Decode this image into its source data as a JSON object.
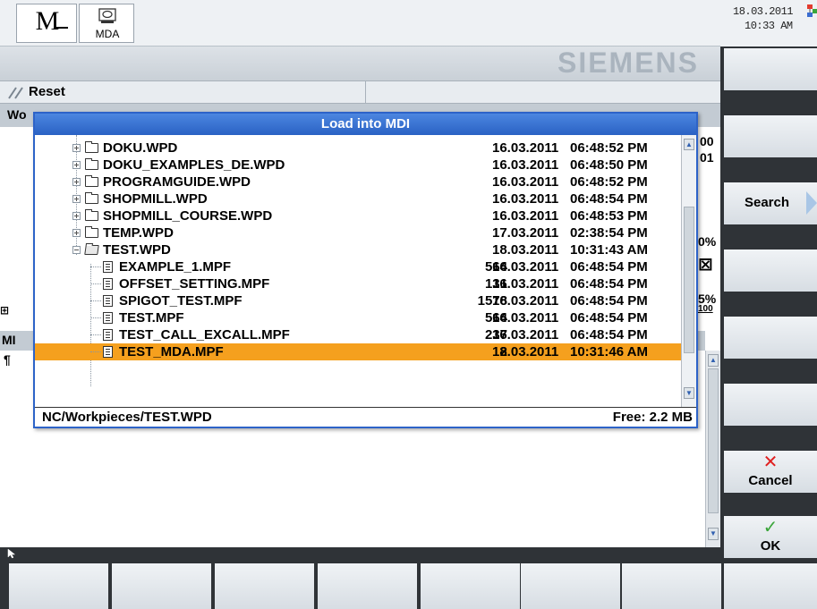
{
  "header": {
    "op_mode_letter": "M",
    "mode_label": "MDA",
    "date": "18.03.2011",
    "time": "10:33 AM"
  },
  "vendor": {
    "logo_text": "SIEMENS"
  },
  "channel_state": {
    "reset_label": "Reset"
  },
  "background": {
    "work_head": "Wo",
    "frag_00": "00",
    "frag_01": "01",
    "frag_pct1": "0%",
    "frag_pct2": "5%",
    "frag_100": "100",
    "frag_mi": "MI",
    "frag_para": "¶"
  },
  "dialog": {
    "title": "Load into MDI",
    "rows": [
      {
        "name": "DOKU.WPD",
        "size": "",
        "date": "16.03.2011",
        "time": "06:48:52 PM"
      },
      {
        "name": "DOKU_EXAMPLES_DE.WPD",
        "size": "",
        "date": "16.03.2011",
        "time": "06:48:50 PM"
      },
      {
        "name": "PROGRAMGUIDE.WPD",
        "size": "",
        "date": "16.03.2011",
        "time": "06:48:52 PM"
      },
      {
        "name": "SHOPMILL.WPD",
        "size": "",
        "date": "16.03.2011",
        "time": "06:48:54 PM"
      },
      {
        "name": "SHOPMILL_COURSE.WPD",
        "size": "",
        "date": "16.03.2011",
        "time": "06:48:53 PM"
      },
      {
        "name": "TEMP.WPD",
        "size": "",
        "date": "17.03.2011",
        "time": "02:38:54 PM"
      },
      {
        "name": "TEST.WPD",
        "size": "",
        "date": "18.03.2011",
        "time": "10:31:43 AM"
      },
      {
        "name": "EXAMPLE_1.MPF",
        "size": "564",
        "date": "16.03.2011",
        "time": "06:48:54 PM"
      },
      {
        "name": "OFFSET_SETTING.MPF",
        "size": "131",
        "date": "16.03.2011",
        "time": "06:48:54 PM"
      },
      {
        "name": "SPIGOT_TEST.MPF",
        "size": "1578",
        "date": "16.03.2011",
        "time": "06:48:54 PM"
      },
      {
        "name": "TEST.MPF",
        "size": "564",
        "date": "16.03.2011",
        "time": "06:48:54 PM"
      },
      {
        "name": "TEST_CALL_EXCALL.MPF",
        "size": "237",
        "date": "16.03.2011",
        "time": "06:48:54 PM"
      },
      {
        "name": "TEST_MDA.MPF",
        "size": "2",
        "date": "18.03.2011",
        "time": "10:31:46 AM"
      }
    ],
    "path": "NC/Workpieces/TEST.WPD",
    "free": "Free: 2.2 MB"
  },
  "softkeys": {
    "search": "Search",
    "cancel": "Cancel",
    "ok": "OK"
  },
  "colors": {
    "selection": "#f5a01e",
    "title_bar": "#2a62c4",
    "cancel_icon": "#e02020",
    "ok_icon": "#3aa53a"
  },
  "icons": [
    "operating-mode-icon",
    "mda-icon",
    "network-icon",
    "reset-icon",
    "folder-icon",
    "file-icon",
    "search-arrow-icon",
    "cancel-x-icon",
    "ok-check-icon",
    "cursor-icon"
  ]
}
